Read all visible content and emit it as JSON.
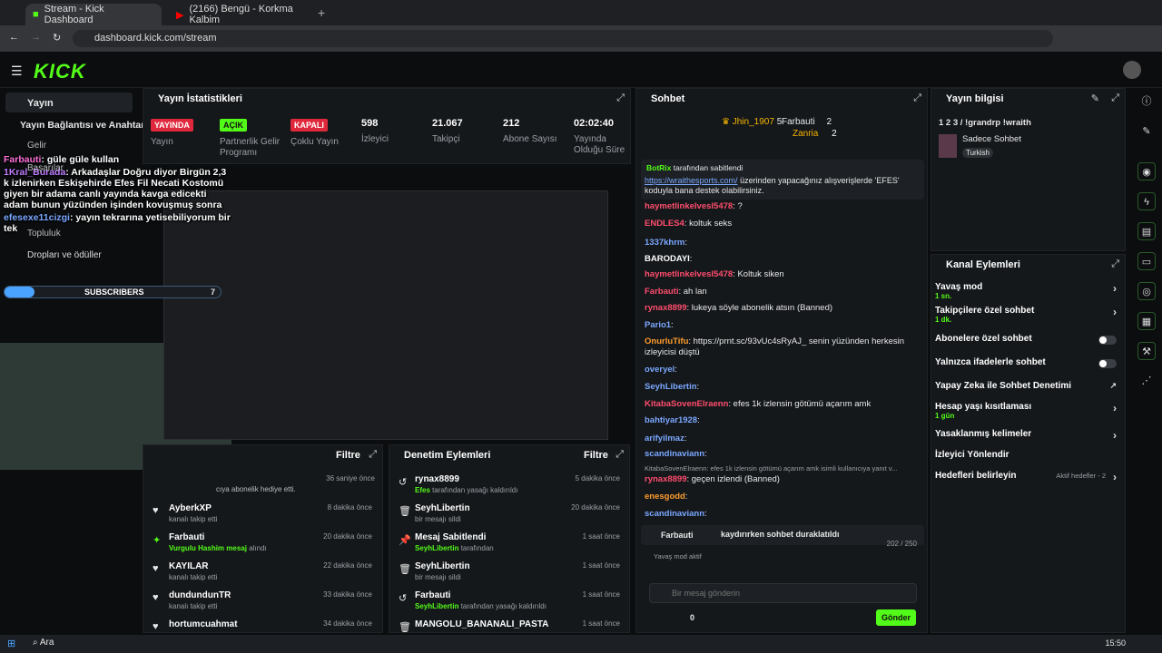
{
  "browser": {
    "tabs": [
      {
        "label": "Stream - Kick Dashboard"
      },
      {
        "label": "(2166) Bengü - Korkma Kalbim"
      }
    ],
    "url": "dashboard.kick.com/stream"
  },
  "logo": "KICK",
  "left_nav": {
    "items": [
      "Yayın",
      "Yayın Bağlantısı ve Anahtarı",
      "Gelir",
      "Başarılar",
      "Topluluk",
      "Dropları ve ödüller"
    ],
    "overlay": {
      "chat": [
        {
          "user": "Farbauti",
          "text": ": güle güle kullan"
        },
        {
          "user": "1Kral_Burada",
          "text": ": Arkadaşlar Doğru diyor Birgün 2,3 k izlenirken Eskişehirde Efes Fil Necati Kostomü giyen bir adama canlı yayında kavga edicekti adam bunun yüzünden işinden kovuşmuş sonra"
        },
        {
          "user": "efesexe11cizgi",
          "text": ": yayın tekrarına yetisebiliyorum bir tek"
        }
      ],
      "sub_label": "SUBSCRIBERS",
      "sub_count": "7"
    }
  },
  "stats": {
    "title": "Yayın İstatistikleri",
    "items": [
      {
        "badge": "YAYINDA",
        "label": "Yayın"
      },
      {
        "badge": "AÇIK",
        "label": "Partnerlik Gelir Programı"
      },
      {
        "badge": "KAPALI",
        "label": "Çoklu Yayın"
      },
      {
        "value": "598",
        "label": "İzleyici"
      },
      {
        "value": "21.067",
        "label": "Takipçi"
      },
      {
        "value": "212",
        "label": "Abone Sayısı"
      },
      {
        "value": "02:02:40",
        "label": "Yayında Olduğu Süre"
      }
    ]
  },
  "activity": {
    "filter": "Filtre",
    "top_note": "cıya abonelik hediye etti.",
    "top_time": "36 saniye önce",
    "items": [
      {
        "name": "AyberkXP",
        "sub": "kanalı takip etti",
        "time": "8 dakika önce"
      },
      {
        "name": "Farbauti",
        "sub": "Vurgulu Hashim mesaj",
        "sub2": "alındı",
        "time": "20 dakika önce"
      },
      {
        "name": "KAYILAR",
        "sub": "kanalı takip etti",
        "time": "22 dakika önce"
      },
      {
        "name": "dundundunTR",
        "sub": "kanalı takip etti",
        "time": "33 dakika önce"
      },
      {
        "name": "hortumcuahmat",
        "sub": "",
        "time": "34 dakika önce"
      }
    ]
  },
  "moderation": {
    "title": "Denetim Eylemleri",
    "filter": "Filtre",
    "items": [
      {
        "name": "rynax8899",
        "sub_user": "Efes",
        "sub": "tarafından yasağı kaldırıldı",
        "time": "5 dakika önce"
      },
      {
        "name": "SeyhLibertin",
        "sub": "bir mesajı sildi",
        "time": "20 dakika önce"
      },
      {
        "name": "Mesaj Sabitlendi",
        "sub_user": "SeyhLibertin",
        "sub": "tarafından",
        "time": "1 saat önce"
      },
      {
        "name": "SeyhLibertin",
        "sub": "bir mesajı sildi",
        "time": "1 saat önce"
      },
      {
        "name": "Farbauti",
        "sub_user": "SeyhLibertin",
        "sub": "tarafından yasağı kaldırıldı",
        "time": "1 saat önce"
      },
      {
        "name": "MANGOLU_BANANALI_PASTA",
        "sub": "",
        "time": "1 saat önce"
      }
    ]
  },
  "chat": {
    "title": "Sohbet",
    "top": [
      {
        "name": "Jhin_1907",
        "count": "5"
      },
      {
        "name": "Farbauti",
        "count": "2"
      },
      {
        "name": "Zanria",
        "count": "2"
      }
    ],
    "pinned": {
      "by": "BotRix",
      "by_suffix": "tarafından sabitlendi",
      "link": "https://wraithesports.com/",
      "text": "üzerinden yapacağınız alışverişlerde 'EFES' koduyla bana destek olabilirsiniz."
    },
    "messages": [
      {
        "user": "haymetlinkelvesl5478",
        "text": ": ?",
        "color": "#ff4d6d"
      },
      {
        "user": "ENDLES4",
        "text": ": koltuk seks",
        "color": "#ff4d6d"
      },
      {
        "user": "1337khrm",
        "text": ":",
        "color": "#7aa8ff"
      },
      {
        "user": "BARODAYI",
        "text": ":",
        "color": "#ffffff"
      },
      {
        "user": "haymetlinkelvesl5478",
        "text": ": Koltuk siken",
        "color": "#ff4d6d"
      },
      {
        "user": "Farbauti",
        "text": ": ah lan",
        "color": "#ff4d6d"
      },
      {
        "user": "rynax8899",
        "text": ": lukeya söyle abonelik atsın (Banned)",
        "color": "#ff4d6d"
      },
      {
        "user": "Pario1",
        "text": ":",
        "color": "#7aa8ff"
      },
      {
        "user": "OnurluTifu",
        "text": ": https://prnt.sc/93vUc4sRyAJ_ senin yüzünden herkesin izleyicisi düştü",
        "color": "#ff9d2e"
      },
      {
        "user": "overyel",
        "text": ":",
        "color": "#7aa8ff"
      },
      {
        "user": "SeyhLibertin",
        "text": ":",
        "color": "#7aa8ff"
      },
      {
        "user": "KitabaSovenElraenn",
        "text": ": efes 1k izlensin götümü açarım amk",
        "color": "#ff4d6d"
      },
      {
        "user": "bahtiyar1928",
        "text": ":",
        "color": "#7aa8ff"
      },
      {
        "user": "arifyilmaz",
        "text": ":",
        "color": "#7aa8ff"
      },
      {
        "user": "scandinaviann",
        "text": ":",
        "color": "#7aa8ff"
      },
      {
        "user": "rynax8899",
        "text": ": geçen izlendi (Banned)",
        "color": "#ff4d6d"
      },
      {
        "user": "enesgodd",
        "text": ":",
        "color": "#ff9d2e"
      },
      {
        "user": "scandinaviann",
        "text": ":",
        "color": "#7aa8ff"
      }
    ],
    "reply_hint": "KitabaSovenElraenn: efes 1k izlensin götümü açarım amk isimli kullanıcıya yanıt v...",
    "paused": "kaydırırken sohbet duraklatıldı",
    "sub_name": "Farbauti",
    "count": "202 / 250",
    "slow": "Yavaş mod aktif",
    "placeholder": "Bir mesaj gönderin",
    "send": "Gönder",
    "zero": "0"
  },
  "stream_info": {
    "title": "Yayın bilgisi",
    "cmd": "1 2 3 / !grandrp !wraith",
    "mode": "Sadece Sohbet",
    "lang": "Turkish"
  },
  "channel_actions": {
    "title": "Kanal Eylemleri",
    "items": [
      {
        "label": "Yavaş mod",
        "sub": "1 sn."
      },
      {
        "label": "Takipçilere özel sohbet",
        "sub": "1 dk."
      },
      {
        "label": "Abonelere özel sohbet"
      },
      {
        "label": "Yalnızca ifadelerle sohbet"
      },
      {
        "label": "Yapay Zeka ile Sohbet Denetimi"
      },
      {
        "label": "Hesap yaşı kısıtlaması",
        "sub": "1 gün"
      },
      {
        "label": "Yasaklanmış kelimeler"
      },
      {
        "label": "İzleyici Yönlendir"
      },
      {
        "label": "Hedefleri belirleyin",
        "note": "Aktif hedefler - 2"
      }
    ]
  },
  "taskbar": {
    "search": "Ara",
    "time": "15:50"
  },
  "colors": {
    "accent": "#53fc18"
  }
}
